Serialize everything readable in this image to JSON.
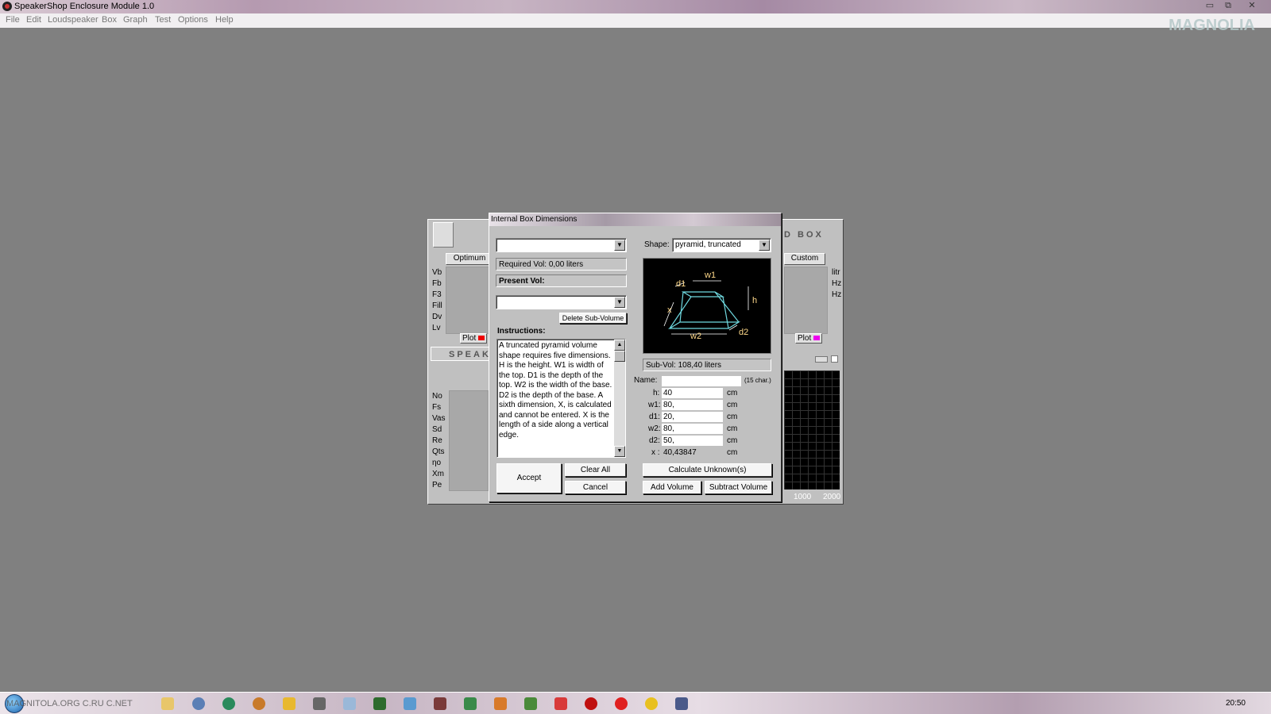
{
  "window": {
    "title": "SpeakerShop Enclosure Module 1.0",
    "controls": [
      "▭",
      "⧉",
      "✕"
    ]
  },
  "menu": [
    "File",
    "Edit",
    "Loudspeaker",
    "Box",
    "Graph",
    "Test",
    "Options",
    "Help"
  ],
  "logo_text": "MAGNOLIA",
  "background_window": {
    "header_right": "D BOX",
    "header_left": "SPEAKE",
    "col_optimum": "Optimum",
    "col_custom": "Custom",
    "box_params": [
      "Vb",
      "Fb",
      "F3",
      "Fill",
      "Dv",
      "Lv"
    ],
    "box_units": [
      "litr",
      "Hz",
      "Hz"
    ],
    "plot_label": "Plot",
    "speaker_params": [
      "No",
      "Fs",
      "Vas",
      "Sd",
      "Re",
      "Qts",
      "ηo",
      "Xm",
      "Pe"
    ],
    "graph_ticks": [
      "1000",
      "2000"
    ]
  },
  "dialog": {
    "title": "Internal Box Dimensions",
    "volume_select": "",
    "required_vol": "Required Vol: 0,00 liters",
    "present_vol_label": "Present Vol:",
    "subvolume_select": "",
    "delete_button": "Delete Sub-Volume",
    "instructions_label": "Instructions:",
    "instructions": "A truncated pyramid volume shape requires five dimensions. H is the height. W1 is width of the top. D1 is the depth of the top. W2 is the width of the base. D2 is the depth of the base. A sixth dimension, X, is calculated and cannot be entered. X is the length of a side along a vertical edge.",
    "accept": "Accept",
    "clear_all": "Clear All",
    "cancel": "Cancel",
    "shape_label": "Shape:",
    "shape_value": "pyramid, truncated",
    "diagram_labels": {
      "w1": "w1",
      "d1": "d1",
      "h": "h",
      "x": "x",
      "w2": "w2",
      "d2": "d2"
    },
    "sub_vol": "Sub-Vol: 108,40 liters",
    "name_label": "Name:",
    "name_value": "",
    "name_hint": "(15 char.)",
    "dims": [
      {
        "label": "h:",
        "value": "40",
        "unit": "cm"
      },
      {
        "label": "w1:",
        "value": "80,",
        "unit": "cm"
      },
      {
        "label": "d1:",
        "value": "20,",
        "unit": "cm"
      },
      {
        "label": "w2:",
        "value": "80,",
        "unit": "cm"
      },
      {
        "label": "d2:",
        "value": "50,",
        "unit": "cm"
      }
    ],
    "x_label": "x :",
    "x_value": "40,43847",
    "x_unit": "cm",
    "calculate": "Calculate Unknown(s)",
    "add_volume": "Add Volume",
    "subtract_volume": "Subtract Volume"
  },
  "taskbar": {
    "watermark": "MAGNITOLA.ORG C.RU C.NET",
    "clock": "20:50",
    "icons": [
      "explorer-icon",
      "chrome-alt-icon",
      "browser-icon",
      "media-icon",
      "player-icon",
      "mouse-icon",
      "docs-icon",
      "calc-icon",
      "brush-icon",
      "books-icon",
      "tool-icon",
      "stack-icon",
      "tree-icon",
      "pdf-icon",
      "opera-icon",
      "yandex-icon",
      "chrome-icon",
      "speakershop-icon"
    ]
  }
}
